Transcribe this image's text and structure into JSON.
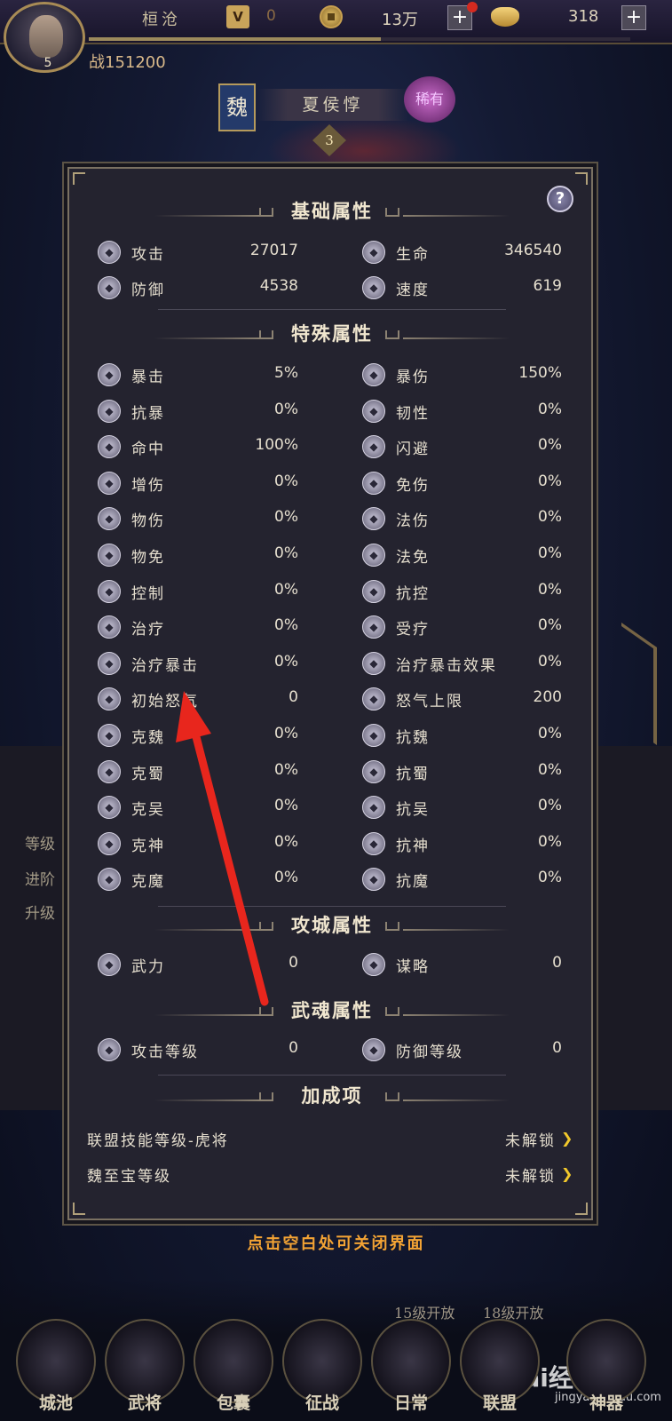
{
  "topbar": {
    "player_name": "桓沧",
    "level": "5",
    "vip_level": "0",
    "coins": "13万",
    "ingots": "318",
    "power": "战151200",
    "exp_progress": 0.54
  },
  "hero": {
    "faction": "魏",
    "name": "夏侯惇",
    "rarity": "稀有",
    "stars": "3"
  },
  "background_panel": {
    "left_labels": [
      "等级",
      "进阶",
      "升级"
    ]
  },
  "modal": {
    "help": "?",
    "sections": {
      "basic": "基础属性",
      "special": "特殊属性",
      "siege": "攻城属性",
      "soul": "武魂属性",
      "bonus": "加成项"
    },
    "basic_attrs": [
      {
        "name": "攻击",
        "value": "27017",
        "icon": "sword-icon"
      },
      {
        "name": "生命",
        "value": "346540",
        "icon": "heart-icon"
      },
      {
        "name": "防御",
        "value": "4538",
        "icon": "shield-icon"
      },
      {
        "name": "速度",
        "value": "619",
        "icon": "speed-icon"
      }
    ],
    "special_attrs": [
      {
        "name": "暴击",
        "value": "5%"
      },
      {
        "name": "暴伤",
        "value": "150%"
      },
      {
        "name": "抗暴",
        "value": "0%"
      },
      {
        "name": "韧性",
        "value": "0%"
      },
      {
        "name": "命中",
        "value": "100%"
      },
      {
        "name": "闪避",
        "value": "0%"
      },
      {
        "name": "增伤",
        "value": "0%"
      },
      {
        "name": "免伤",
        "value": "0%"
      },
      {
        "name": "物伤",
        "value": "0%"
      },
      {
        "name": "法伤",
        "value": "0%"
      },
      {
        "name": "物免",
        "value": "0%"
      },
      {
        "name": "法免",
        "value": "0%"
      },
      {
        "name": "控制",
        "value": "0%"
      },
      {
        "name": "抗控",
        "value": "0%"
      },
      {
        "name": "治疗",
        "value": "0%"
      },
      {
        "name": "受疗",
        "value": "0%"
      },
      {
        "name": "治疗暴击",
        "value": "0%"
      },
      {
        "name": "治疗暴击效果",
        "value": "0%"
      },
      {
        "name": "初始怒气",
        "value": "0"
      },
      {
        "name": "怒气上限",
        "value": "200"
      },
      {
        "name": "克魏",
        "value": "0%"
      },
      {
        "name": "抗魏",
        "value": "0%"
      },
      {
        "name": "克蜀",
        "value": "0%"
      },
      {
        "name": "抗蜀",
        "value": "0%"
      },
      {
        "name": "克吴",
        "value": "0%"
      },
      {
        "name": "抗吴",
        "value": "0%"
      },
      {
        "name": "克神",
        "value": "0%"
      },
      {
        "name": "抗神",
        "value": "0%"
      },
      {
        "name": "克魔",
        "value": "0%"
      },
      {
        "name": "抗魔",
        "value": "0%"
      }
    ],
    "siege_attrs": [
      {
        "name": "武力",
        "value": "0"
      },
      {
        "name": "谋略",
        "value": "0"
      }
    ],
    "soul_attrs": [
      {
        "name": "攻击等级",
        "value": "0"
      },
      {
        "name": "防御等级",
        "value": "0"
      }
    ],
    "bonus_items": [
      {
        "name": "联盟技能等级-虎将",
        "status": "未解锁"
      },
      {
        "name": "魏至宝等级",
        "status": "未解锁"
      }
    ]
  },
  "close_hint": "点击空白处可关闭界面",
  "bottom_nav": {
    "lock_labels": [
      "15级开放",
      "18级开放"
    ],
    "items": [
      "城池",
      "武将",
      "包囊",
      "征战",
      "日常",
      "联盟",
      "神器"
    ]
  },
  "watermark": {
    "brand": "Bai经验",
    "url": "jingyan.baidu.com"
  },
  "colors": {
    "accent": "#f3a334",
    "arrow": "#f1c82c",
    "annotation": "#e8261d"
  }
}
